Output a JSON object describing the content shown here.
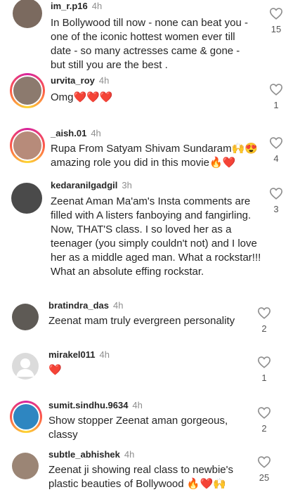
{
  "comments": [
    {
      "user": "im_r.p16",
      "time": "4h",
      "text": "In Bollywood till now - none can beat you - one of the iconic hottest women ever till date - so many actresses came & gone - but still you are the best .",
      "likes": "15",
      "avatar_color": "#7b6a5f"
    },
    {
      "user": "urvita_roy",
      "time": "4h",
      "text": "Omg❤️❤️❤️",
      "likes": "1",
      "avatar_color": "#8c7a6e"
    },
    {
      "user": "_aish.01",
      "time": "4h",
      "text": "Rupa From Satyam Shivam Sundaram🙌😍 amazing role you did in this movie🔥❤️",
      "likes": "4",
      "avatar_color": "#b78b7a"
    },
    {
      "user": "kedaranilgadgil",
      "time": "3h",
      "text": "Zeenat Aman Ma'am's Insta comments are filled with A listers fanboying and fangirling. Now, THAT'S class. I so loved her as a teenager (you simply couldn't not) and I love her as a middle aged man. What a rockstar!!! What an absolute effing rockstar.",
      "likes": "3",
      "avatar_color": "#4a4a4a"
    },
    {
      "user": "bratindra_das",
      "time": "4h",
      "text": "Zeenat mam truly evergreen personality",
      "likes": "2",
      "avatar_color": "#5e5a55"
    },
    {
      "user": "mirakel011",
      "time": "4h",
      "text": "❤️",
      "likes": "1",
      "avatar_color": "#dbdbdb"
    },
    {
      "user": "sumit.sindhu.9634",
      "time": "4h",
      "text": "Show stopper Zeenat aman gorgeous, classy",
      "likes": "2",
      "avatar_color": "#2e86c1"
    },
    {
      "user": "subtle_abhishek",
      "time": "4h",
      "text": "Zeenat ji showing real class to newbie's plastic beauties of Bollywood 🔥❤️🙌",
      "likes": "25",
      "avatar_color": "#9b8575"
    }
  ]
}
